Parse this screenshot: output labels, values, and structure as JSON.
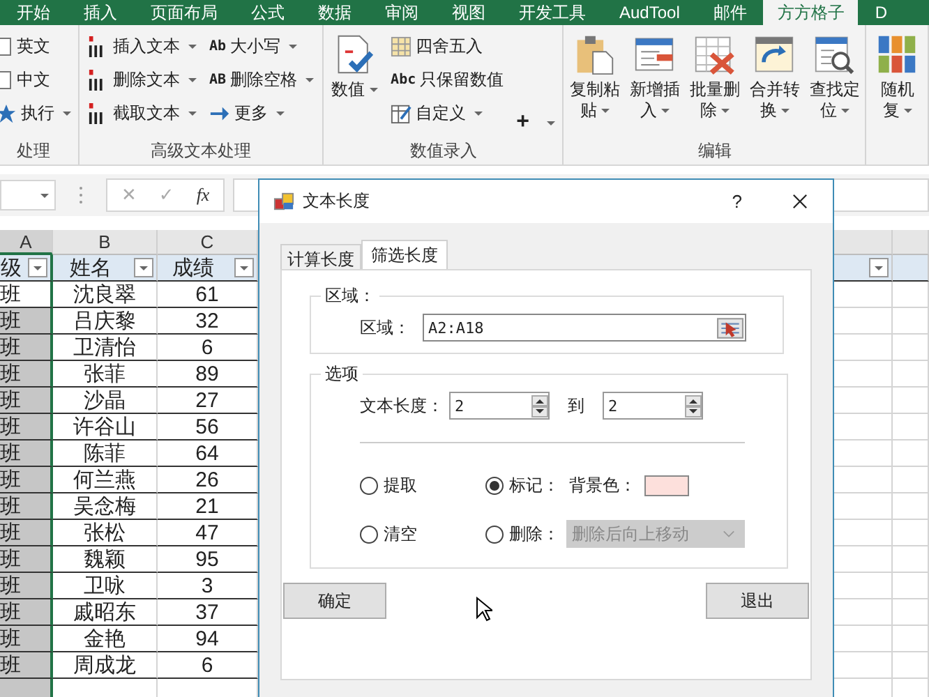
{
  "ribbon_tabs": [
    {
      "label": "开始",
      "selected": false
    },
    {
      "label": "插入",
      "selected": false
    },
    {
      "label": "页面布局",
      "selected": false
    },
    {
      "label": "公式",
      "selected": false
    },
    {
      "label": "数据",
      "selected": false
    },
    {
      "label": "审阅",
      "selected": false
    },
    {
      "label": "视图",
      "selected": false
    },
    {
      "label": "开发工具",
      "selected": false
    },
    {
      "label": "AudTool",
      "selected": false
    },
    {
      "label": "邮件",
      "selected": false
    },
    {
      "label": "方方格子",
      "selected": true
    },
    {
      "label": "D",
      "selected": false
    }
  ],
  "ribbon_groups": [
    {
      "label": "处理",
      "columns": [
        [
          {
            "kind": "check",
            "label": "英文",
            "checked": false
          },
          {
            "kind": "check",
            "label": "中文",
            "checked": false
          },
          {
            "kind": "small",
            "label": "执行",
            "dropdown": true
          }
        ]
      ]
    },
    {
      "label": "高级文本处理",
      "columns": [
        [
          {
            "kind": "small",
            "label": "插入文本",
            "dropdown": true
          },
          {
            "kind": "small",
            "label": "删除文本",
            "dropdown": true
          },
          {
            "kind": "small",
            "label": "截取文本",
            "dropdown": true
          }
        ],
        [
          {
            "kind": "small",
            "label": "大小写",
            "icon_text": "Ab",
            "dropdown": true
          },
          {
            "kind": "small",
            "label": "删除空格",
            "icon_text": "AB",
            "dropdown": true
          },
          {
            "kind": "small",
            "label": "更多",
            "dropdown": true
          }
        ]
      ]
    },
    {
      "label": "数值录入",
      "columns": [
        [
          {
            "kind": "large",
            "label": "数值",
            "dropdown": true
          }
        ],
        [
          {
            "kind": "small",
            "label": "四舍五入",
            "dropdown": false
          },
          {
            "kind": "small",
            "label": "只保留数值",
            "icon_text": "Abc",
            "dropdown": false
          },
          {
            "kind": "small",
            "label": "自定义",
            "dropdown": true
          }
        ],
        [
          {
            "kind": "symbol",
            "label": "+",
            "dropdown": true
          }
        ]
      ]
    },
    {
      "label": "编辑",
      "columns": [
        [
          {
            "kind": "large",
            "label": "复制粘贴",
            "dropdown": true
          }
        ],
        [
          {
            "kind": "large",
            "label": "新增插入",
            "dropdown": true
          }
        ],
        [
          {
            "kind": "large",
            "label": "批量删除",
            "dropdown": true
          }
        ],
        [
          {
            "kind": "large",
            "label": "合并转换",
            "dropdown": true
          }
        ],
        [
          {
            "kind": "large",
            "label": "查找定位",
            "dropdown": true
          }
        ]
      ]
    },
    {
      "columns": [
        [
          {
            "kind": "large",
            "label": "随机",
            "label_2": "复",
            "dropdown": true
          }
        ]
      ]
    }
  ],
  "formula_bar": {
    "cancel": "✕",
    "enter": "✓",
    "function": "fx"
  },
  "sheet": {
    "column_letters": [
      "A",
      "B",
      "C"
    ],
    "header_row": [
      {
        "text": "级",
        "filter": true
      },
      {
        "text": "姓名",
        "filter": true
      },
      {
        "text": "成绩",
        "filter": true
      },
      {
        "filter": true
      }
    ],
    "rows": [
      {
        "active": true,
        "cells": [
          "班",
          "沈良翠",
          "61"
        ]
      },
      {
        "active": false,
        "cells": [
          "班",
          "吕庆黎",
          "32"
        ]
      },
      {
        "active": false,
        "cells": [
          "班",
          "卫清怡",
          "6"
        ]
      },
      {
        "active": false,
        "cells": [
          "班",
          "张菲",
          "89"
        ]
      },
      {
        "active": false,
        "cells": [
          "班",
          "沙晶",
          "27"
        ]
      },
      {
        "active": false,
        "cells": [
          "班",
          "许谷山",
          "56"
        ]
      },
      {
        "active": false,
        "cells": [
          "班",
          "陈菲",
          "64"
        ]
      },
      {
        "active": false,
        "cells": [
          "班",
          "何兰燕",
          "26"
        ]
      },
      {
        "active": false,
        "cells": [
          "班",
          "吴念梅",
          "21"
        ]
      },
      {
        "active": false,
        "cells": [
          "班",
          "张松",
          "47"
        ]
      },
      {
        "active": false,
        "cells": [
          "班",
          "魏颖",
          "95"
        ]
      },
      {
        "active": false,
        "cells": [
          "班",
          "卫咏",
          "3"
        ]
      },
      {
        "active": false,
        "cells": [
          "班",
          "戚昭东",
          "37"
        ]
      },
      {
        "active": false,
        "cells": [
          "班",
          "金艳",
          "94"
        ]
      },
      {
        "active": false,
        "cells": [
          "班",
          "周成龙",
          "6"
        ]
      }
    ]
  },
  "dialog": {
    "title": "文本长度",
    "help": "?",
    "tabs": [
      {
        "label": "计算长度",
        "selected": false
      },
      {
        "label": "筛选长度",
        "selected": true
      }
    ],
    "range_group": {
      "legend": "区域：",
      "label": "区域：",
      "value": "A2:A18"
    },
    "options_group": {
      "legend": "选项",
      "length_label": "文本长度：",
      "from": "2",
      "to_label": "到",
      "to": "2",
      "radios": [
        {
          "label": "提取",
          "selected": false
        },
        {
          "label": "标记：",
          "selected": true
        },
        {
          "label": "清空",
          "selected": false
        },
        {
          "label": "删除：",
          "selected": false
        }
      ],
      "background": {
        "label": "背景色：",
        "color": "#fde0dc"
      },
      "delete_mode": {
        "value": "删除后向上移动",
        "disabled": true
      }
    },
    "buttons": [
      {
        "label": "确定"
      },
      {
        "label": "退出"
      }
    ]
  }
}
